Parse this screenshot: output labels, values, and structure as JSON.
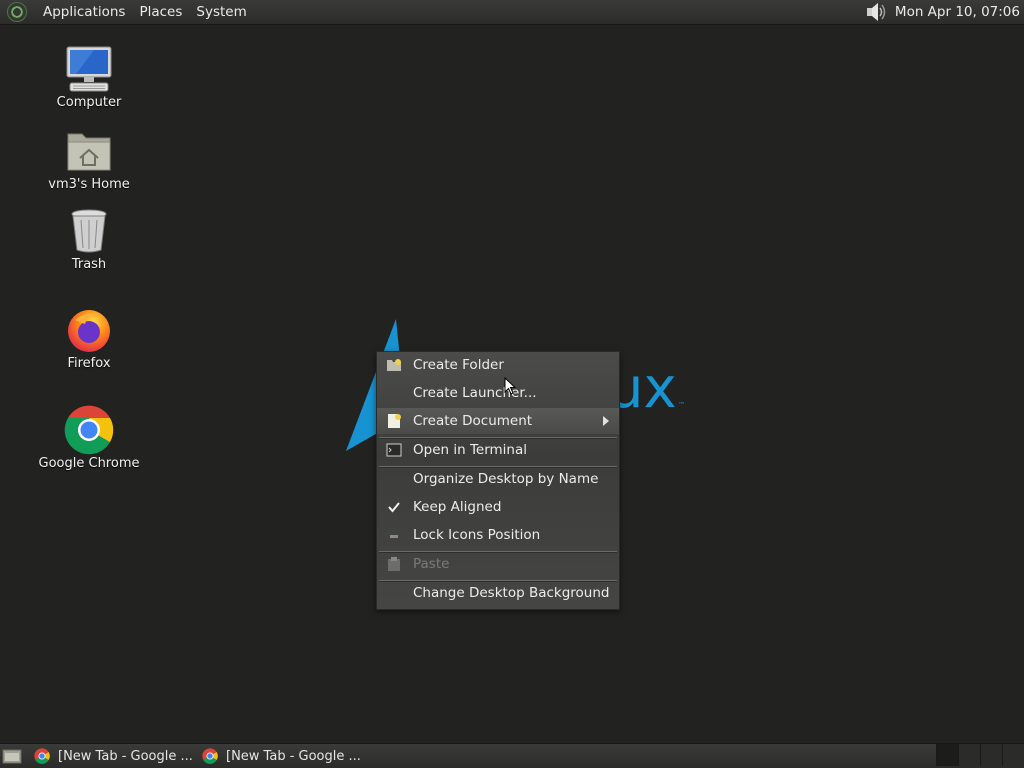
{
  "top_panel": {
    "menus": [
      "Applications",
      "Places",
      "System"
    ],
    "clock": "Mon Apr 10, 07:06"
  },
  "desktop_icons": [
    {
      "label": "Computer",
      "icon": "computer-icon"
    },
    {
      "label": "vm3's Home",
      "icon": "home-folder-icon"
    },
    {
      "label": "Trash",
      "icon": "trash-icon"
    },
    {
      "label": "Firefox",
      "icon": "firefox-icon"
    },
    {
      "label": "Google Chrome",
      "icon": "chrome-icon"
    }
  ],
  "wallpaper": {
    "logo_text": "ux",
    "brand_color": "#1793d1"
  },
  "context_menu": {
    "items": [
      {
        "label": "Create Folder",
        "icon": "new-folder-icon"
      },
      {
        "label": "Create Launcher...",
        "icon": ""
      },
      {
        "label": "Create Document",
        "icon": "new-document-icon",
        "submenu": true,
        "highlighted": true
      },
      {
        "label": "Open in Terminal",
        "icon": "terminal-icon"
      },
      {
        "label": "Organize Desktop by Name",
        "icon": ""
      },
      {
        "label": "Keep Aligned",
        "icon": "checkmark-icon",
        "checked": true
      },
      {
        "label": "Lock Icons Position",
        "icon": "unchecked-icon",
        "checked": false
      },
      {
        "label": "Paste",
        "icon": "paste-icon",
        "disabled": true
      },
      {
        "label": "Change Desktop Background",
        "icon": ""
      }
    ]
  },
  "taskbar": {
    "tasks": [
      {
        "label": "[New Tab - Google ...",
        "icon": "chrome-icon"
      },
      {
        "label": "[New Tab - Google ...",
        "icon": "chrome-icon"
      }
    ]
  }
}
